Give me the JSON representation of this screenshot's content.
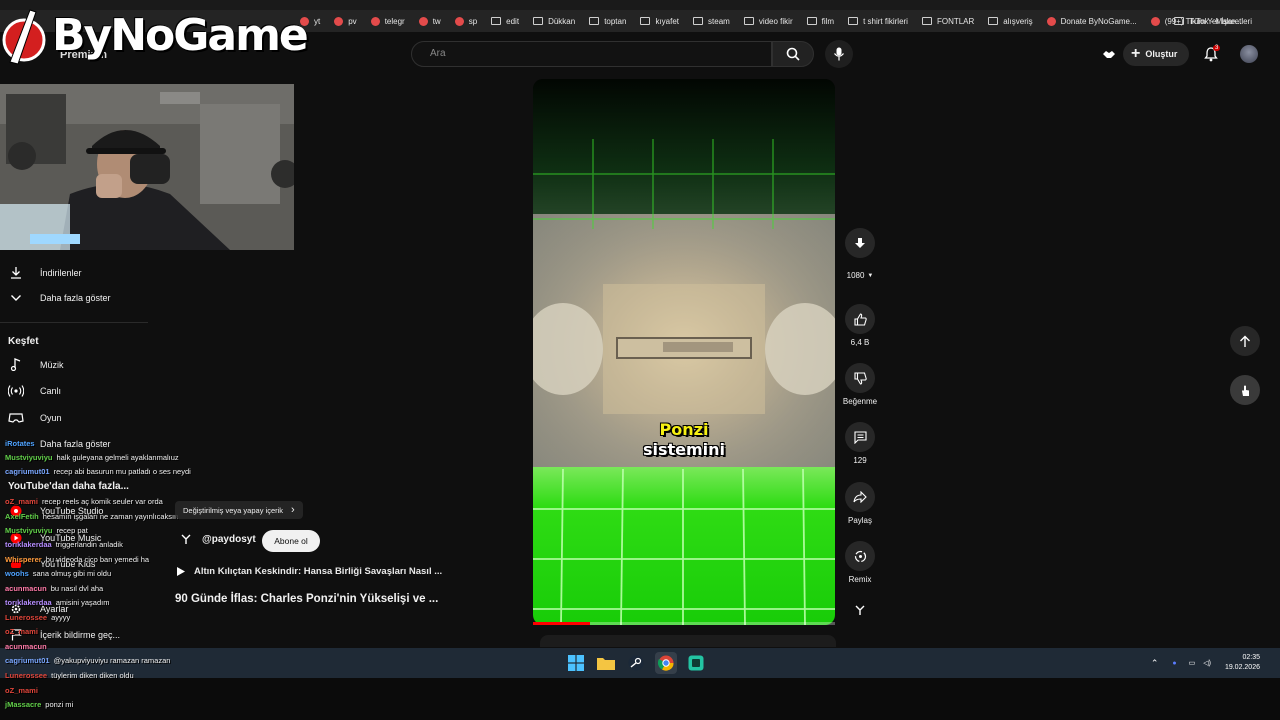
{
  "logo": {
    "text": "ByNoGame"
  },
  "browser": {
    "bookmarks": [
      {
        "label": "yt",
        "kind": "favicon"
      },
      {
        "label": "pv",
        "kind": "favicon"
      },
      {
        "label": "telegr",
        "kind": "favicon"
      },
      {
        "label": "tw",
        "kind": "favicon"
      },
      {
        "label": "sp",
        "kind": "favicon"
      },
      {
        "label": "edit",
        "kind": "folder"
      },
      {
        "label": "Dükkan",
        "kind": "folder"
      },
      {
        "label": "toptan",
        "kind": "folder"
      },
      {
        "label": "kıyafet",
        "kind": "folder"
      },
      {
        "label": "steam",
        "kind": "folder"
      },
      {
        "label": "video fikir",
        "kind": "folder"
      },
      {
        "label": "film",
        "kind": "folder"
      },
      {
        "label": "t shirt fikirleri",
        "kind": "folder"
      },
      {
        "label": "FONTLAR",
        "kind": "folder"
      },
      {
        "label": "alışveriş",
        "kind": "folder"
      },
      {
        "label": "Donate ByNoGame...",
        "kind": "favicon"
      },
      {
        "label": "(99+) TikTok - Make...",
        "kind": "favicon"
      }
    ],
    "all_bookmarks": "Tüm Yer İşaretleri"
  },
  "header": {
    "premium_label": "Premium",
    "search_placeholder": "Ara",
    "create_label": "Oluştur",
    "notification_count": "3"
  },
  "sidebar": {
    "items_top": [
      {
        "label": "İndirilenler",
        "icon": "download-icon"
      },
      {
        "label": "Daha fazla göster",
        "icon": "chevron-down-icon"
      }
    ],
    "explore_title": "Keşfet",
    "explore_items": [
      {
        "label": "Müzik",
        "icon": "music-note-icon"
      },
      {
        "label": "Canlı",
        "icon": "live-icon"
      },
      {
        "label": "Oyun",
        "icon": "gamepad-icon"
      }
    ],
    "more_label": "Daha fazla göster",
    "yt_more_title": "YouTube'dan daha fazla...",
    "yt_studio": "YouTube Studio",
    "yt_music": "YouTube Music",
    "yt_kids": "YouTube Kids",
    "settings": "Ayarlar",
    "report": "İçerik bildirme geç..."
  },
  "chat": [
    {
      "user": "iRotates",
      "msg": "",
      "color": "#4fa3ff"
    },
    {
      "user": "Mustviyuviyu",
      "msg": "halk guleyana gelmeli ayaklanmalıuz",
      "color": "#62d04a"
    },
    {
      "user": "cagriumut01",
      "msg": "recep abi basurun mu patladı o ses neydi",
      "color": "#7aa7ff"
    },
    {
      "user": "oZ_mami",
      "msg": "recep reels aç komik seuler var orda",
      "color": "#e0453a"
    },
    {
      "user": "AxelFetih",
      "msg": "hesamın işgaları ne zaman yayınlıcaksın",
      "color": "#62d04a"
    },
    {
      "user": "Mustviyuviyu",
      "msg": "recep pat",
      "color": "#62d04a"
    },
    {
      "user": "torıklakerdaa",
      "msg": "triggerlandin anladik",
      "color": "#b58cff"
    },
    {
      "user": "Whisperer",
      "msg": "bu videoda cico ban yemedi ha",
      "color": "#ff9b3d"
    },
    {
      "user": "woohs",
      "msg": "sana olmuş gibi mi oldu",
      "color": "#4fa3ff"
    },
    {
      "user": "acunmacun",
      "msg": "bu nasıl dvl aha",
      "color": "#ff7aa8"
    },
    {
      "user": "torıklakerdaa",
      "msg": "amisini yaşadım",
      "color": "#b58cff"
    },
    {
      "user": "Lunerossee",
      "msg": "ayyyy",
      "color": "#e0453a"
    },
    {
      "user": "oZ_mami",
      "msg": "",
      "color": "#e0453a"
    },
    {
      "user": "acunmacun",
      "msg": "",
      "color": "#ff7aa8"
    },
    {
      "user": "cagriumut01",
      "msg": "@yakupviyuviyu ramazan ramazan",
      "color": "#7aa7ff"
    },
    {
      "user": "Lunerossee",
      "msg": "tüylerim diken diken oldu",
      "color": "#e0453a"
    },
    {
      "user": "oZ_mami",
      "msg": "",
      "color": "#e0453a"
    },
    {
      "user": "jMassacre",
      "msg": "ponzi mi",
      "color": "#62d04a"
    }
  ],
  "short": {
    "ai_label": "Değiştirilmiş veya yapay içerik",
    "channel": "@paydosyt",
    "subscribe": "Abone ol",
    "linked_video": "Altın Kılıçtan Keskindir: Hansa Birliği Savaşları Nasıl ...",
    "title": "90 Günde İflas: Charles Ponzi'nin Yükselişi ve ...",
    "caption_line1": "Ponzi",
    "caption_line2": "sistemini",
    "progress_percent": 19
  },
  "actions": {
    "quality": "1080",
    "like_count": "6,4 B",
    "dislike_label": "Beğenme",
    "comment_count": "129",
    "share_label": "Paylaş",
    "remix_label": "Remix"
  },
  "taskbar": {
    "time": "02:35",
    "date": "19.02.2026"
  }
}
